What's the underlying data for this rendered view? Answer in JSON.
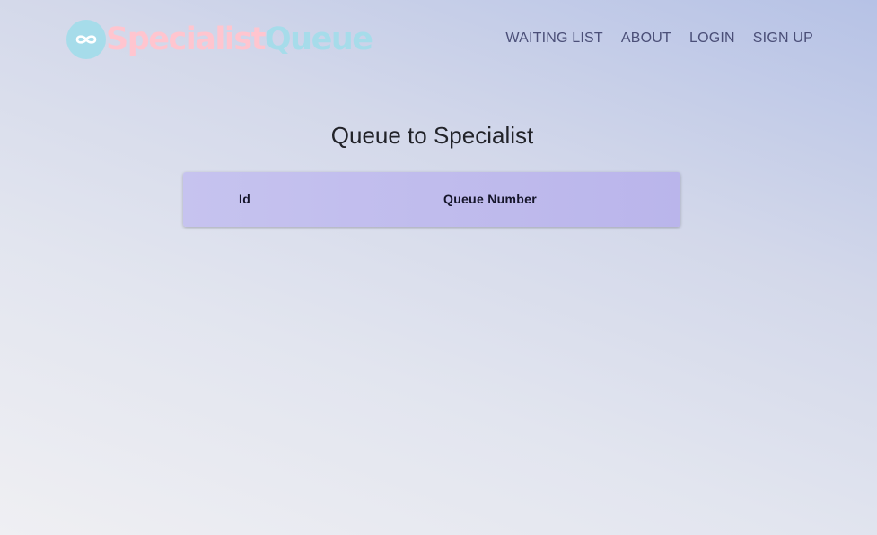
{
  "brand": {
    "icon": "infinity-icon",
    "name_part1": "Specialist",
    "name_part2": "Queue"
  },
  "nav": {
    "items": [
      "WAITING LIST",
      "ABOUT",
      "LOGIN",
      "SIGN UP"
    ]
  },
  "page": {
    "title": "Queue to Specialist"
  },
  "table": {
    "columns": [
      "Id",
      "Queue Number"
    ],
    "rows": []
  },
  "colors": {
    "brand_pink": "#ffc5cf",
    "brand_blue": "#a6dcea",
    "nav_text": "#4b4f78",
    "table_header": "#c0bcee"
  }
}
